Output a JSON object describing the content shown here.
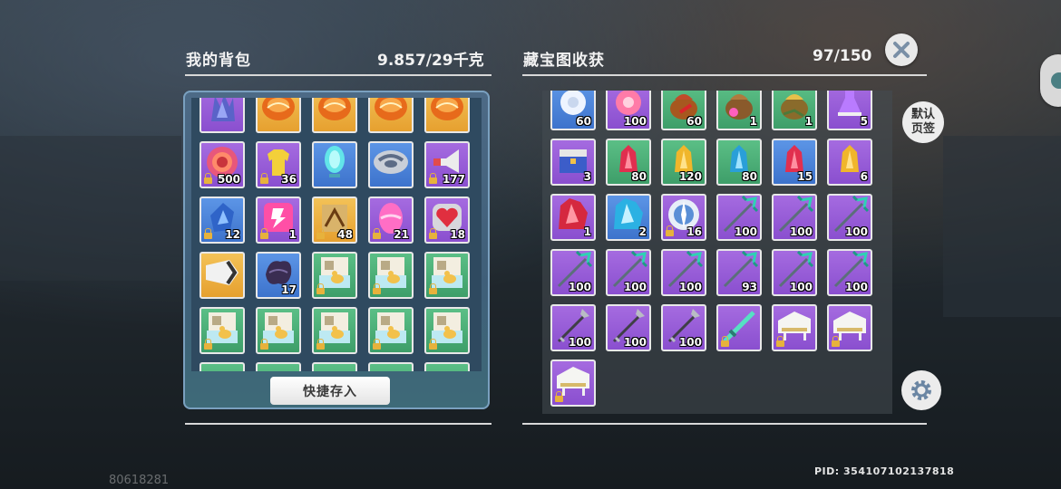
{
  "bag": {
    "title": "我的背包",
    "weight": "9.857/29千克",
    "quick_store_label": "快捷存入",
    "slots": [
      {
        "item": "purple-tower",
        "rarity": "purple",
        "qty": "",
        "lock": false
      },
      {
        "item": "orange-orb",
        "rarity": "orange",
        "qty": "",
        "lock": false
      },
      {
        "item": "orange-orb",
        "rarity": "orange",
        "qty": "",
        "lock": false
      },
      {
        "item": "orange-orb",
        "rarity": "orange",
        "qty": "",
        "lock": false
      },
      {
        "item": "orange-orb",
        "rarity": "orange",
        "qty": "",
        "lock": false
      },
      {
        "item": "ruby-coin",
        "rarity": "purple",
        "qty": "500",
        "lock": true
      },
      {
        "item": "yellow-shirt",
        "rarity": "purple",
        "qty": "36",
        "lock": true
      },
      {
        "item": "cyan-crystal",
        "rarity": "blue",
        "qty": "",
        "lock": false
      },
      {
        "item": "gray-disc",
        "rarity": "blue",
        "qty": "",
        "lock": false
      },
      {
        "item": "megaphone",
        "rarity": "purple",
        "qty": "177",
        "lock": true
      },
      {
        "item": "blue-gem-shard",
        "rarity": "blue",
        "qty": "12",
        "lock": true
      },
      {
        "item": "pink-token",
        "rarity": "purple",
        "qty": "1",
        "lock": true
      },
      {
        "item": "treasure-map",
        "rarity": "orange",
        "qty": "48",
        "lock": true
      },
      {
        "item": "pink-egg",
        "rarity": "purple",
        "qty": "21",
        "lock": true
      },
      {
        "item": "heart-gem",
        "rarity": "purple",
        "qty": "18",
        "lock": true
      },
      {
        "item": "horn",
        "rarity": "orange",
        "qty": "",
        "lock": false
      },
      {
        "item": "dark-leaf",
        "rarity": "blue",
        "qty": "17",
        "lock": false
      },
      {
        "item": "duck-cube",
        "rarity": "green",
        "qty": "",
        "lock": true
      },
      {
        "item": "duck-cube",
        "rarity": "green",
        "qty": "",
        "lock": true
      },
      {
        "item": "duck-cube",
        "rarity": "green",
        "qty": "",
        "lock": true
      },
      {
        "item": "duck-cube",
        "rarity": "green",
        "qty": "",
        "lock": true
      },
      {
        "item": "duck-cube",
        "rarity": "green",
        "qty": "",
        "lock": true
      },
      {
        "item": "duck-cube",
        "rarity": "green",
        "qty": "",
        "lock": true
      },
      {
        "item": "duck-cube",
        "rarity": "green",
        "qty": "",
        "lock": true
      },
      {
        "item": "duck-cube",
        "rarity": "green",
        "qty": "",
        "lock": true
      },
      {
        "item": "partial",
        "rarity": "green",
        "qty": "",
        "lock": false
      },
      {
        "item": "partial",
        "rarity": "green",
        "qty": "",
        "lock": false
      },
      {
        "item": "partial",
        "rarity": "green",
        "qty": "",
        "lock": false
      },
      {
        "item": "partial",
        "rarity": "green",
        "qty": "",
        "lock": false
      },
      {
        "item": "partial",
        "rarity": "green",
        "qty": "",
        "lock": false
      }
    ]
  },
  "rewards": {
    "title": "藏宝图收获",
    "count": "97/150",
    "slots": [
      {
        "item": "white-flower",
        "rarity": "blue",
        "qty": "60",
        "lock": false
      },
      {
        "item": "pink-flower",
        "rarity": "purple",
        "qty": "100",
        "lock": false
      },
      {
        "item": "red-seed-bag",
        "rarity": "green",
        "qty": "60",
        "lock": false
      },
      {
        "item": "pink-seed-bag",
        "rarity": "green",
        "qty": "1",
        "lock": false
      },
      {
        "item": "gold-seed-bag",
        "rarity": "green",
        "qty": "1",
        "lock": false
      },
      {
        "item": "potion",
        "rarity": "purple",
        "qty": "5",
        "lock": false
      },
      {
        "item": "blue-chest",
        "rarity": "purple",
        "qty": "3",
        "lock": false
      },
      {
        "item": "red-crystal",
        "rarity": "green",
        "qty": "80",
        "lock": false
      },
      {
        "item": "yellow-crystal",
        "rarity": "green",
        "qty": "120",
        "lock": false
      },
      {
        "item": "blue-crystal",
        "rarity": "green",
        "qty": "80",
        "lock": false
      },
      {
        "item": "red-crystal",
        "rarity": "blue",
        "qty": "15",
        "lock": false
      },
      {
        "item": "yellow-crystal",
        "rarity": "purple",
        "qty": "6",
        "lock": false
      },
      {
        "item": "big-red-crystal",
        "rarity": "purple",
        "qty": "1",
        "lock": false
      },
      {
        "item": "big-blue-crystal",
        "rarity": "blue",
        "qty": "2",
        "lock": false
      },
      {
        "item": "compass-emblem",
        "rarity": "purple",
        "qty": "16",
        "lock": true
      },
      {
        "item": "trident",
        "rarity": "purple",
        "qty": "100",
        "lock": false
      },
      {
        "item": "trident",
        "rarity": "purple",
        "qty": "100",
        "lock": false
      },
      {
        "item": "trident",
        "rarity": "purple",
        "qty": "100",
        "lock": false
      },
      {
        "item": "trident",
        "rarity": "purple",
        "qty": "100",
        "lock": false
      },
      {
        "item": "trident",
        "rarity": "purple",
        "qty": "100",
        "lock": false
      },
      {
        "item": "trident",
        "rarity": "purple",
        "qty": "100",
        "lock": false
      },
      {
        "item": "trident",
        "rarity": "purple",
        "qty": "93",
        "lock": false
      },
      {
        "item": "trident",
        "rarity": "purple",
        "qty": "100",
        "lock": false
      },
      {
        "item": "trident",
        "rarity": "purple",
        "qty": "100",
        "lock": false
      },
      {
        "item": "spear",
        "rarity": "purple",
        "qty": "100",
        "lock": false
      },
      {
        "item": "spear",
        "rarity": "purple",
        "qty": "100",
        "lock": false
      },
      {
        "item": "spear",
        "rarity": "purple",
        "qty": "100",
        "lock": false
      },
      {
        "item": "green-sword",
        "rarity": "purple",
        "qty": "",
        "lock": true
      },
      {
        "item": "white-piano",
        "rarity": "purple",
        "qty": "",
        "lock": true
      },
      {
        "item": "white-piano",
        "rarity": "purple",
        "qty": "",
        "lock": true
      },
      {
        "item": "white-piano",
        "rarity": "purple",
        "qty": "",
        "lock": true
      }
    ]
  },
  "tab_button": {
    "line1": "默认",
    "line2": "页签"
  },
  "pid": "PID: 354107102137818",
  "uid_watermark": "80618281",
  "colors": {
    "orange": "#f0b645",
    "purple": "#9a5ed9",
    "blue": "#4d85dc",
    "green": "#4fb079"
  }
}
